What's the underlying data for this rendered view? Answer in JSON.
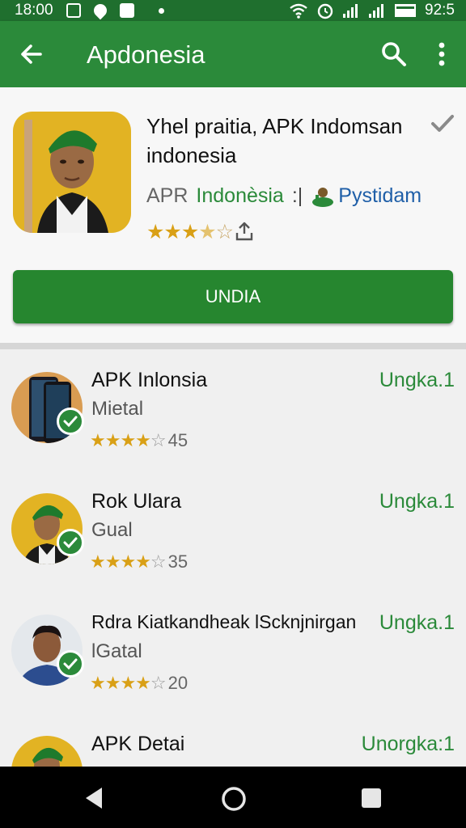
{
  "status_bar": {
    "time": "18:00",
    "clock_right": "92:5",
    "icons": [
      "image-icon",
      "location-pin-icon",
      "download-icon",
      "dot-icon",
      "wifi-icon",
      "alarm-icon",
      "signal-icon",
      "signal-icon",
      "battery-icon"
    ]
  },
  "app_bar": {
    "title": "Apdonesia",
    "icons": [
      "back-arrow-icon",
      "search-icon",
      "more-vert-icon"
    ]
  },
  "hero": {
    "title": "Yhel praitia, APK Indomsan indonesia",
    "developer_part1": "APR",
    "developer_part2": "Indonèsia",
    "developer_sep": ":|",
    "developer_part3": "Pystidam",
    "stars": "★★★",
    "half_star": "★",
    "empty_star": "☆",
    "install_label": "UNDIA"
  },
  "list": [
    {
      "name": "APK Inlonsia",
      "subtitle": "Mietal",
      "stars": "★★★★",
      "empty_star": "☆",
      "count": "45",
      "action": "Ungka.1",
      "thumb": "phone-image"
    },
    {
      "name": "Rok Ulara",
      "subtitle": "Gual",
      "stars": "★★★★",
      "empty_star": "☆",
      "count": "35",
      "action": "Ungka.1",
      "thumb": "person-green-cap"
    },
    {
      "name": "Rdra Kiatkandheak lScknjnirgan",
      "subtitle": "lGatal",
      "stars": "★★★★",
      "empty_star": "☆",
      "count": "20",
      "action": "Ungka.1",
      "thumb": "person-blue-shirt"
    },
    {
      "name": "APK Detai",
      "subtitle": "",
      "stars": "",
      "empty_star": "",
      "count": "",
      "action": "Unorgka:1",
      "thumb": "person-green-cap"
    }
  ],
  "nav": {
    "icons": [
      "nav-back-icon",
      "nav-home-icon",
      "nav-recents-icon"
    ]
  },
  "colors": {
    "app_bar": "#2b8a3a",
    "status_bar": "#1f6f2e",
    "accent": "#26862f",
    "star": "#d9a016"
  }
}
